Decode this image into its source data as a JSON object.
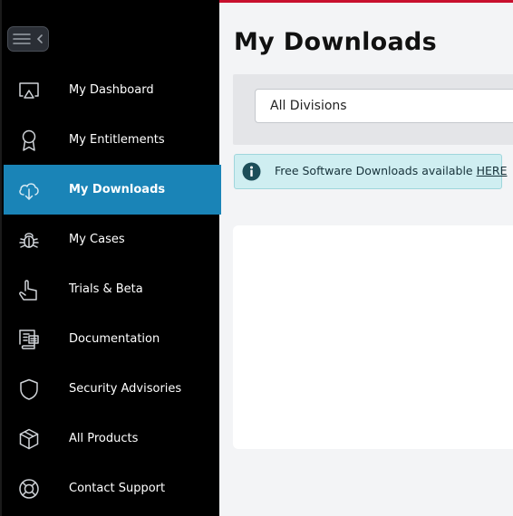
{
  "sidebar": {
    "toggle_label": "Collapse sidebar",
    "items": [
      {
        "label": "My Dashboard",
        "icon": "dashboard-icon",
        "active": false
      },
      {
        "label": "My Entitlements",
        "icon": "award-ribbon-icon",
        "active": false
      },
      {
        "label": "My Downloads",
        "icon": "cloud-download-icon",
        "active": true
      },
      {
        "label": "My Cases",
        "icon": "bug-icon",
        "active": false
      },
      {
        "label": "Trials & Beta",
        "icon": "pointer-hand-icon",
        "active": false
      },
      {
        "label": "Documentation",
        "icon": "document-scroll-icon",
        "active": false
      },
      {
        "label": "Security Advisories",
        "icon": "shield-icon",
        "active": false
      },
      {
        "label": "All Products",
        "icon": "cube-box-icon",
        "active": false
      },
      {
        "label": "Contact Support",
        "icon": "lifebuoy-icon",
        "active": false
      }
    ]
  },
  "main": {
    "title": "My Downloads",
    "filter": {
      "division_value": "All Divisions"
    },
    "banner": {
      "text": "Free Software Downloads available ",
      "link_text": "HERE"
    }
  },
  "colors": {
    "brand_red": "#c8102e",
    "active_blue": "#1a84b7",
    "banner_bg": "#cfeef1",
    "info_icon": "#1d4e59"
  }
}
